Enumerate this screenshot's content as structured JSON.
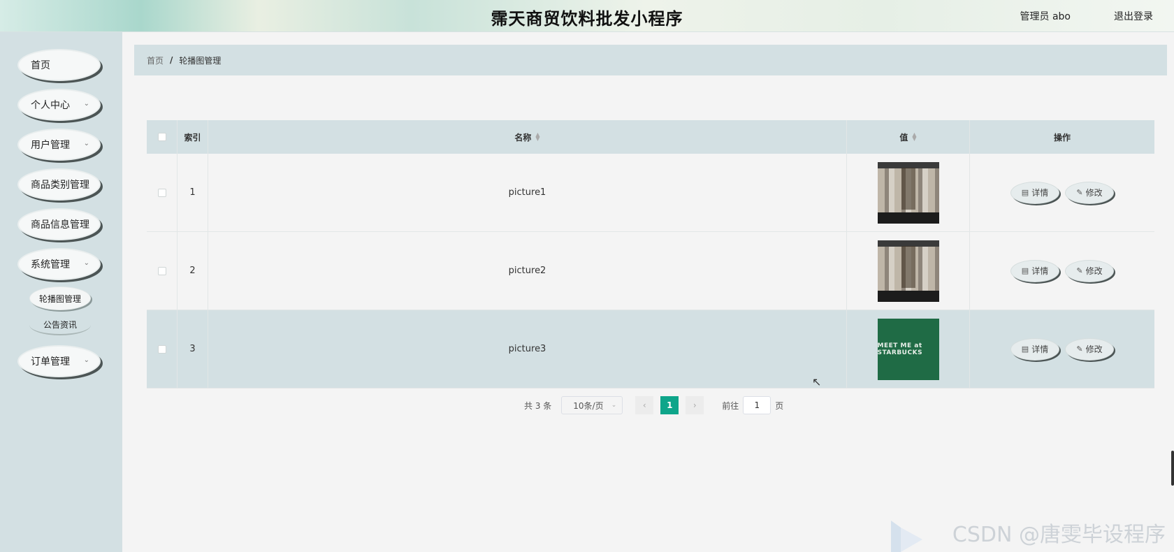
{
  "header": {
    "title": "霈天商贸饮料批发小程序",
    "user_label": "管理员 abo",
    "logout_label": "退出登录"
  },
  "sidebar": {
    "items": [
      {
        "label": "首页",
        "has_children": false
      },
      {
        "label": "个人中心",
        "has_children": true
      },
      {
        "label": "用户管理",
        "has_children": true
      },
      {
        "label": "商品类别管理",
        "has_children": false
      },
      {
        "label": "商品信息管理",
        "has_children": false
      },
      {
        "label": "系统管理",
        "has_children": true
      },
      {
        "label": "订单管理",
        "has_children": true
      }
    ],
    "sub_items": [
      {
        "label": "轮播图管理",
        "active": true
      },
      {
        "label": "公告资讯",
        "active": false
      }
    ]
  },
  "breadcrumb": {
    "home": "首页",
    "separator": "/",
    "current": "轮播图管理"
  },
  "table": {
    "columns": [
      "",
      "索引",
      "名称",
      "值",
      "操作"
    ],
    "rows": [
      {
        "index": "1",
        "name": "picture1",
        "thumb": "collage"
      },
      {
        "index": "2",
        "name": "picture2",
        "thumb": "collage"
      },
      {
        "index": "3",
        "name": "picture3",
        "thumb": "green",
        "thumb_text": "MEET ME at STARBUCKS"
      }
    ],
    "actions": {
      "detail": "详情",
      "edit": "修改"
    }
  },
  "pagination": {
    "total": "共 3 条",
    "page_size": "10条/页",
    "current_page": "1",
    "goto_label": "前往",
    "goto_value": "1",
    "page_unit": "页"
  },
  "watermark": "CSDN @唐雯毕设程序",
  "colors": {
    "accent": "#0ea58a",
    "panel": "#d3e0e3",
    "background": "#f4f4f4"
  }
}
